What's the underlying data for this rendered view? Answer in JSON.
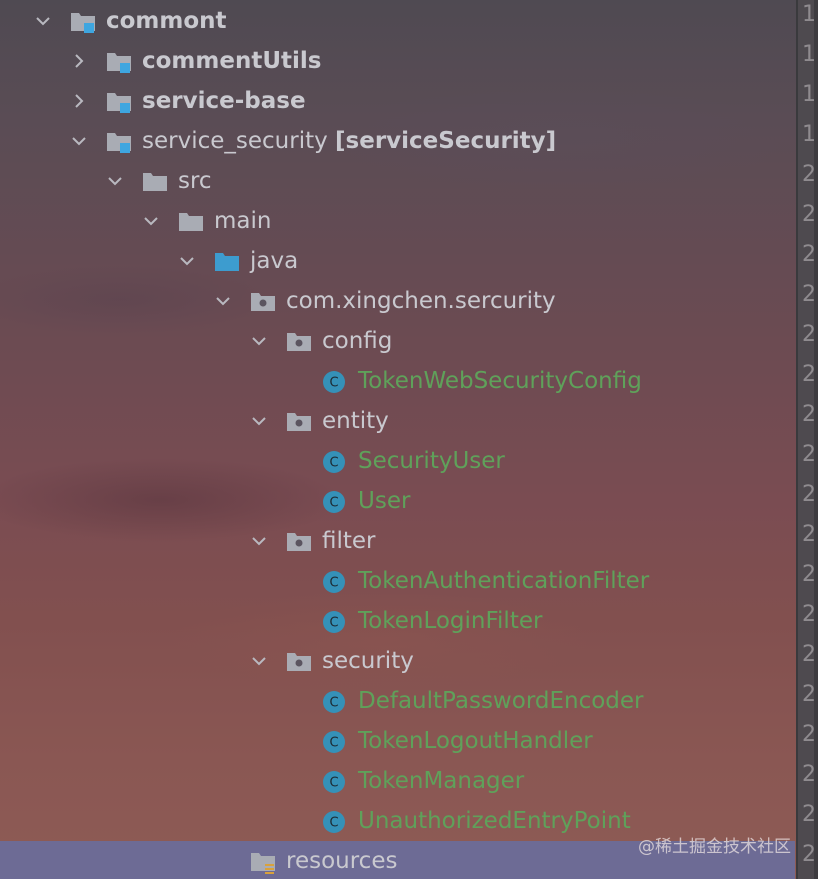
{
  "tree": {
    "rows": [
      {
        "id": "commont",
        "label": "commont",
        "type": "module",
        "expanded": true,
        "level": 0,
        "bold": true
      },
      {
        "id": "commentutils",
        "label": "commentUtils",
        "type": "module",
        "expanded": false,
        "level": 1,
        "bold": true
      },
      {
        "id": "service-base",
        "label": "service-base",
        "type": "module",
        "expanded": false,
        "level": 1,
        "bold": true
      },
      {
        "id": "service-security",
        "label": "service_security ",
        "suffix": "[serviceSecurity]",
        "type": "module",
        "expanded": true,
        "level": 1,
        "bold": false
      },
      {
        "id": "src",
        "label": "src",
        "type": "folder",
        "expanded": true,
        "level": 2
      },
      {
        "id": "main",
        "label": "main",
        "type": "folder",
        "expanded": true,
        "level": 3
      },
      {
        "id": "java",
        "label": "java",
        "type": "source-folder",
        "expanded": true,
        "level": 4
      },
      {
        "id": "package-root",
        "label": "com.xingchen.sercurity",
        "type": "package",
        "expanded": true,
        "level": 5
      },
      {
        "id": "config",
        "label": "config",
        "type": "package",
        "expanded": true,
        "level": 6
      },
      {
        "id": "tokenwebsecurityconfig",
        "label": "TokenWebSecurityConfig",
        "type": "class",
        "level": 7
      },
      {
        "id": "entity",
        "label": "entity",
        "type": "package",
        "expanded": true,
        "level": 6
      },
      {
        "id": "securityuser",
        "label": "SecurityUser",
        "type": "class",
        "level": 7
      },
      {
        "id": "user",
        "label": "User",
        "type": "class",
        "level": 7
      },
      {
        "id": "filter",
        "label": "filter",
        "type": "package",
        "expanded": true,
        "level": 6
      },
      {
        "id": "tokenauthenticationfilter",
        "label": "TokenAuthenticationFilter",
        "type": "class",
        "level": 7
      },
      {
        "id": "tokenloginfilter",
        "label": "TokenLoginFilter",
        "type": "class",
        "level": 7
      },
      {
        "id": "security",
        "label": "security",
        "type": "package",
        "expanded": true,
        "level": 6
      },
      {
        "id": "defaultpasswordencoder",
        "label": "DefaultPasswordEncoder",
        "type": "class",
        "level": 7
      },
      {
        "id": "tokenlogouthandler",
        "label": "TokenLogoutHandler",
        "type": "class",
        "level": 7
      },
      {
        "id": "tokenmanager",
        "label": "TokenManager",
        "type": "class",
        "level": 7
      },
      {
        "id": "unauthorizedentrypoint",
        "label": "UnauthorizedEntryPoint",
        "type": "class",
        "level": 7
      },
      {
        "id": "resources",
        "label": "resources",
        "type": "resources-folder",
        "level": 5,
        "selected": true
      }
    ]
  },
  "gutter": {
    "numbers": [
      "1",
      "1",
      "1",
      "1",
      "2",
      "2",
      "2",
      "2",
      "2",
      "2",
      "2",
      "2",
      "2",
      "2",
      "2",
      "2",
      "2",
      "2",
      "2",
      "2",
      "2",
      "2"
    ]
  },
  "watermark": {
    "text": "@稀土掘金技术社区"
  },
  "colors": {
    "selection": "#6d6b95",
    "class_label": "#5fa15a",
    "default_label": "#c9c9cf",
    "module_badge": "#3ea6e0",
    "folder": "#a9acb4",
    "source_folder": "#3d9ccf",
    "class_icon": "#3591b8"
  },
  "icons": {
    "module": "module-folder-icon",
    "folder": "folder-icon",
    "source-folder": "source-folder-icon",
    "package": "package-icon",
    "class": "java-class-icon",
    "resources-folder": "resources-folder-icon",
    "expanded": "chevron-down-icon",
    "collapsed": "chevron-right-icon"
  }
}
